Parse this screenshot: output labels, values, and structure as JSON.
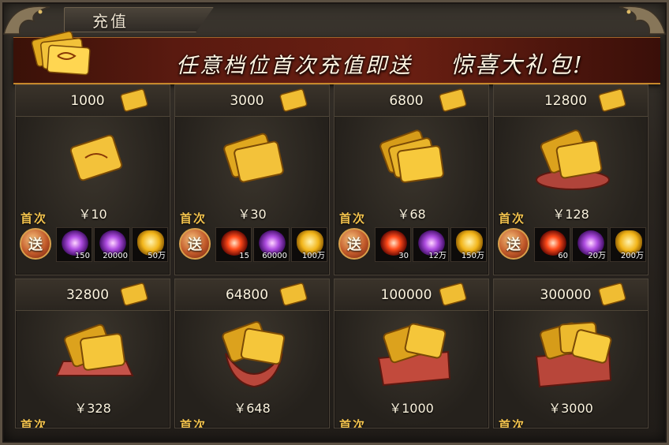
{
  "window": {
    "title": "充值"
  },
  "banner": {
    "text": "任意档位首次充值即送",
    "highlight": "惊喜大礼包!"
  },
  "labels": {
    "first_recharge": "首次",
    "send": "送"
  },
  "colors": {
    "accent_gold": "#f2c24d",
    "banner_red": "#6a1f12",
    "text_cream": "#fbf3de"
  },
  "tiers": [
    {
      "amount": "1000",
      "price": "￥10",
      "icon": "gold-ticket-icon",
      "gifts": [
        {
          "icon": "purple-orb-icon",
          "count": "150"
        },
        {
          "icon": "purple-orb-icon",
          "count": "20000"
        },
        {
          "icon": "gold-ingot-icon",
          "count": "50万"
        }
      ]
    },
    {
      "amount": "3000",
      "price": "￥30",
      "icon": "gold-ticket-pair-icon",
      "gifts": [
        {
          "icon": "red-orb-icon",
          "count": "15"
        },
        {
          "icon": "purple-orb-icon",
          "count": "60000"
        },
        {
          "icon": "gold-ingot-icon",
          "count": "100万"
        }
      ]
    },
    {
      "amount": "6800",
      "price": "￥68",
      "icon": "gold-ticket-stack-icon",
      "gifts": [
        {
          "icon": "red-orb-icon",
          "count": "30"
        },
        {
          "icon": "purple-orb-icon",
          "count": "12万"
        },
        {
          "icon": "gold-ingot-icon",
          "count": "150万"
        }
      ]
    },
    {
      "amount": "12800",
      "price": "￥128",
      "icon": "gold-ticket-pile-icon",
      "gifts": [
        {
          "icon": "red-orb-icon",
          "count": "60"
        },
        {
          "icon": "purple-orb-icon",
          "count": "20万"
        },
        {
          "icon": "gold-ingot-icon",
          "count": "200万"
        }
      ]
    },
    {
      "amount": "32800",
      "price": "￥328",
      "icon": "gold-ticket-cushion-icon",
      "gifts": []
    },
    {
      "amount": "64800",
      "price": "￥648",
      "icon": "gold-ticket-bag-icon",
      "gifts": []
    },
    {
      "amount": "100000",
      "price": "￥1000",
      "icon": "gold-ticket-box-icon",
      "gifts": []
    },
    {
      "amount": "300000",
      "price": "￥3000",
      "icon": "gold-ticket-chest-icon",
      "gifts": []
    }
  ]
}
